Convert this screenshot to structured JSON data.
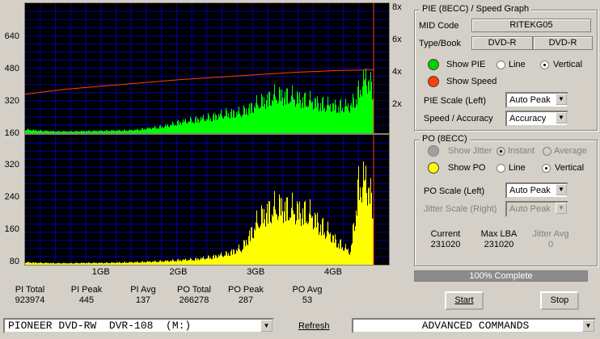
{
  "chart_data": [
    {
      "type": "area",
      "title": "",
      "series": [
        {
          "name": "PIE",
          "color": "#00ff00",
          "x": [
            0,
            0.2,
            0.4,
            0.6,
            0.8,
            1.0,
            1.2,
            1.4,
            1.6,
            1.8,
            2.0,
            2.2,
            2.4,
            2.6,
            2.8,
            3.0,
            3.1,
            3.2,
            3.3,
            3.4,
            3.5,
            3.6,
            3.7,
            3.8,
            3.9,
            4.0,
            4.1,
            4.2,
            4.3,
            4.4,
            4.5
          ],
          "y": [
            30,
            20,
            15,
            15,
            18,
            20,
            22,
            25,
            40,
            55,
            90,
            110,
            130,
            160,
            170,
            240,
            270,
            300,
            310,
            300,
            290,
            270,
            260,
            240,
            230,
            220,
            220,
            220,
            330,
            460,
            340
          ]
        },
        {
          "name": "Speed",
          "color": "#ff4000",
          "x": [
            0,
            0.5,
            1.0,
            1.5,
            2.0,
            2.5,
            3.0,
            3.5,
            4.0,
            4.5
          ],
          "y": [
            2.4,
            2.7,
            2.9,
            3.1,
            3.3,
            3.45,
            3.6,
            3.75,
            3.85,
            3.9
          ]
        }
      ],
      "x_tick_labels": [
        "1GB",
        "2GB",
        "3GB",
        "4GB"
      ],
      "xlim": [
        0,
        4.7
      ],
      "y_tick_labels": [
        "640",
        "480",
        "320",
        "160"
      ],
      "ylim": [
        0,
        800
      ],
      "y2_tick_labels": [
        "8x",
        "6x",
        "4x",
        "2x"
      ],
      "y2lim": [
        0,
        8
      ]
    },
    {
      "type": "area",
      "title": "",
      "series": [
        {
          "name": "PO",
          "color": "#ffff00",
          "x": [
            0,
            0.2,
            0.4,
            0.6,
            0.8,
            1.0,
            1.2,
            1.4,
            1.6,
            1.8,
            2.0,
            2.2,
            2.4,
            2.6,
            2.8,
            3.0,
            3.1,
            3.2,
            3.3,
            3.4,
            3.5,
            3.6,
            3.7,
            3.8,
            3.9,
            4.0,
            4.1,
            4.2,
            4.3,
            4.4,
            4.5
          ],
          "y": [
            8,
            6,
            5,
            5,
            6,
            6,
            7,
            8,
            10,
            12,
            15,
            18,
            25,
            35,
            55,
            140,
            170,
            180,
            190,
            180,
            175,
            170,
            160,
            130,
            110,
            80,
            60,
            40,
            250,
            280,
            180
          ]
        }
      ],
      "y_tick_labels": [
        "320",
        "240",
        "160",
        "80"
      ],
      "ylim": [
        0,
        320
      ],
      "xlim": [
        0,
        4.7
      ]
    }
  ],
  "stats": [
    {
      "label": "PI Total",
      "value": "923974"
    },
    {
      "label": "PI Peak",
      "value": "445"
    },
    {
      "label": "PI Avg",
      "value": "137"
    },
    {
      "label": "PO Total",
      "value": "266278"
    },
    {
      "label": "PO Peak",
      "value": "287"
    },
    {
      "label": "PO Avg",
      "value": "53"
    }
  ],
  "pie_panel": {
    "title": "PIE (8ECC) / Speed Graph",
    "mid_code_label": "MID Code",
    "mid_code_value": "RITEKG05",
    "type_book_label": "Type/Book",
    "type_value": "DVD-R",
    "book_value": "DVD-R",
    "show_pie_label": "Show PIE",
    "line_label": "Line",
    "vertical_label": "Vertical",
    "show_speed_label": "Show Speed",
    "pie_scale_label": "PIE Scale (Left)",
    "pie_scale_value": "Auto Peak",
    "speed_accuracy_label": "Speed / Accuracy",
    "speed_accuracy_value": "Accuracy",
    "pie_color": "#00d000",
    "speed_color": "#ff4000"
  },
  "po_panel": {
    "title": "PO (8ECC)",
    "show_jitter_label": "Show Jitter",
    "instant_label": "Instant",
    "average_label": "Average",
    "show_po_label": "Show PO",
    "line_label": "Line",
    "vertical_label": "Vertical",
    "po_scale_label": "PO Scale (Left)",
    "po_scale_value": "Auto Peak",
    "jitter_scale_label": "Jitter Scale (Right)",
    "jitter_scale_value": "Auto Peak",
    "current_label": "Current",
    "current_value": "231020",
    "max_lba_label": "Max LBA",
    "max_lba_value": "231020",
    "jitter_avg_label": "Jitter Avg",
    "jitter_avg_value": "0",
    "po_color": "#ffff00"
  },
  "progress": {
    "text": "100% Complete",
    "fraction": 1.0
  },
  "buttons": {
    "start": "Start",
    "stop": "Stop",
    "refresh": "Refresh"
  },
  "drive_select": "PIONEER DVD-RW  DVR-108  (M:)",
  "commands_select": "ADVANCED COMMANDS"
}
